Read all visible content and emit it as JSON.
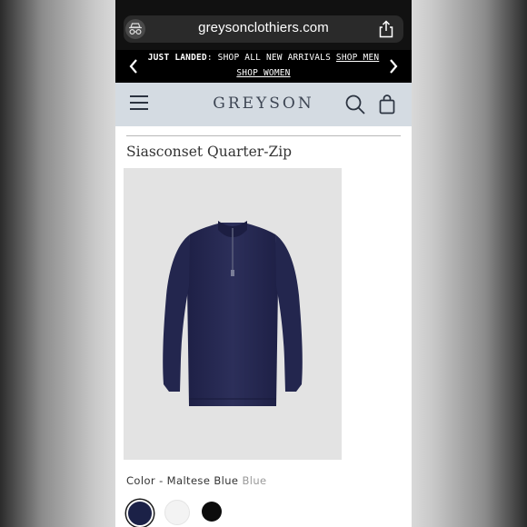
{
  "browser": {
    "url": "greysonclothiers.com"
  },
  "promo": {
    "bold_text": "JUST LANDED",
    "text": ": SHOP ALL NEW ARRIVALS ",
    "link_men": "SHOP MEN",
    "link_women": "SHOP WOMEN"
  },
  "header": {
    "logo": "GREYSON"
  },
  "product": {
    "title": "Siasconset Quarter-Zip",
    "color_label": "Color - Maltese Blue",
    "color_value": "Blue",
    "swatches": [
      {
        "name": "maltese-blue",
        "color": "#1b2147",
        "selected": true
      },
      {
        "name": "white",
        "color": "#f3f3f3",
        "selected": false
      },
      {
        "name": "black",
        "color": "#0c0c0c",
        "selected": false
      }
    ]
  },
  "colors": {
    "header_bg": "#d4dbe2",
    "promo_bg": "#000000",
    "product_bg": "#e3e3e3",
    "garment": "#272a52"
  }
}
